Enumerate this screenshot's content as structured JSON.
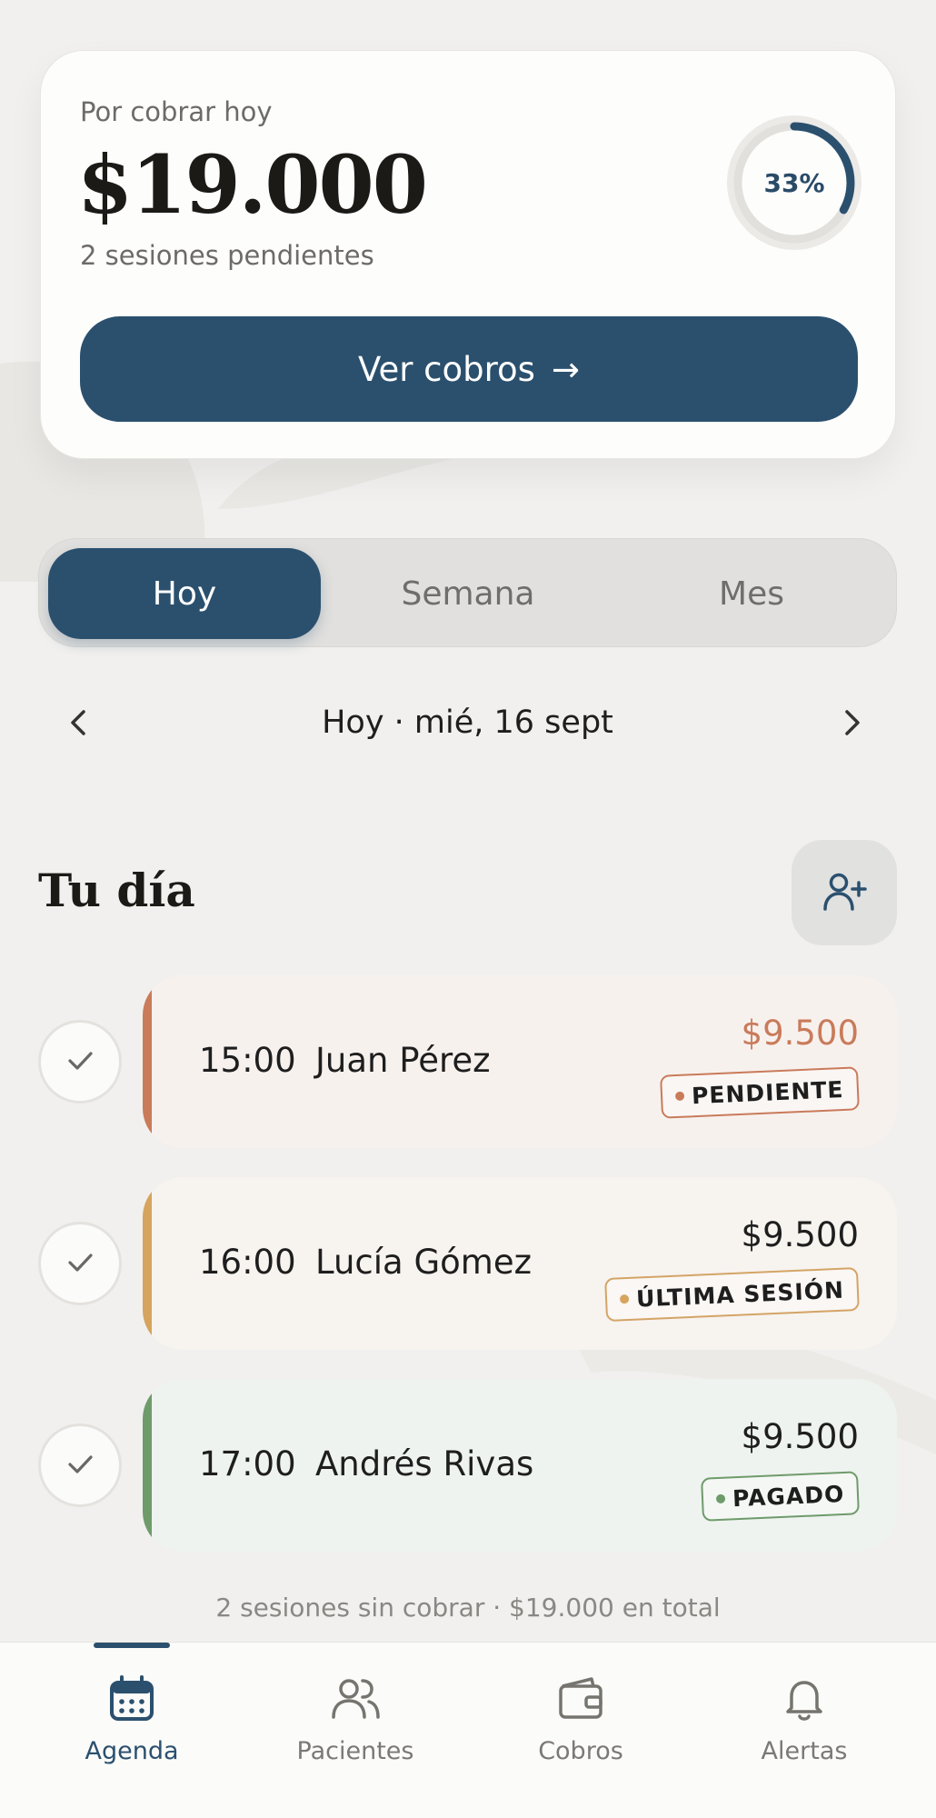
{
  "summary": {
    "label": "Por cobrar hoy",
    "amount": "$19.000",
    "pending_sessions": "2 sesiones pendientes",
    "progress_text": "33%",
    "progress_fraction": 0.33,
    "button_label": "Ver cobros",
    "button_arrow": "→"
  },
  "segments": [
    {
      "label": "Hoy",
      "active": true
    },
    {
      "label": "Semana",
      "active": false
    },
    {
      "label": "Mes",
      "active": false
    }
  ],
  "date_nav": {
    "label": "Hoy · mié, 16 sept",
    "prev_icon": "chevron-left-icon",
    "next_icon": "chevron-right-icon"
  },
  "section": {
    "title": "Tu día",
    "add_icon": "add-user-icon"
  },
  "sessions": [
    {
      "time": "15:00",
      "name": "Juan Pérez",
      "amount": "$9.500",
      "status": "PENDIENTE",
      "accent": "#c97b5a",
      "amount_color": "#c97b5a",
      "card_bg": "#f7f1ee",
      "badge_color": "#c97b5a"
    },
    {
      "time": "16:00",
      "name": "Lucía Gómez",
      "amount": "$9.500",
      "status": "ÚLTIMA SESIÓN",
      "accent": "#d6a45e",
      "amount_color": "#1e1e1e",
      "card_bg": "#f7f3ef",
      "badge_color": "#d4a466"
    },
    {
      "time": "17:00",
      "name": "Andrés Rivas",
      "amount": "$9.500",
      "status": "PAGADO",
      "accent": "#6f9b6b",
      "amount_color": "#1e1e1e",
      "card_bg": "#eef3ef",
      "badge_color": "#6f9b6b"
    }
  ],
  "totals": "2 sesiones sin cobrar · $19.000 en total",
  "bottom_nav": [
    {
      "label": "Agenda",
      "icon": "calendar-icon",
      "active": true
    },
    {
      "label": "Pacientes",
      "icon": "users-icon",
      "active": false
    },
    {
      "label": "Cobros",
      "icon": "wallet-icon",
      "active": false
    },
    {
      "label": "Alertas",
      "icon": "bell-icon",
      "active": false
    }
  ],
  "colors": {
    "primary": "#2b506e",
    "background": "#f1f0ee",
    "pending": "#c97b5a",
    "last_session": "#d6a45e",
    "paid": "#6f9b6b"
  }
}
